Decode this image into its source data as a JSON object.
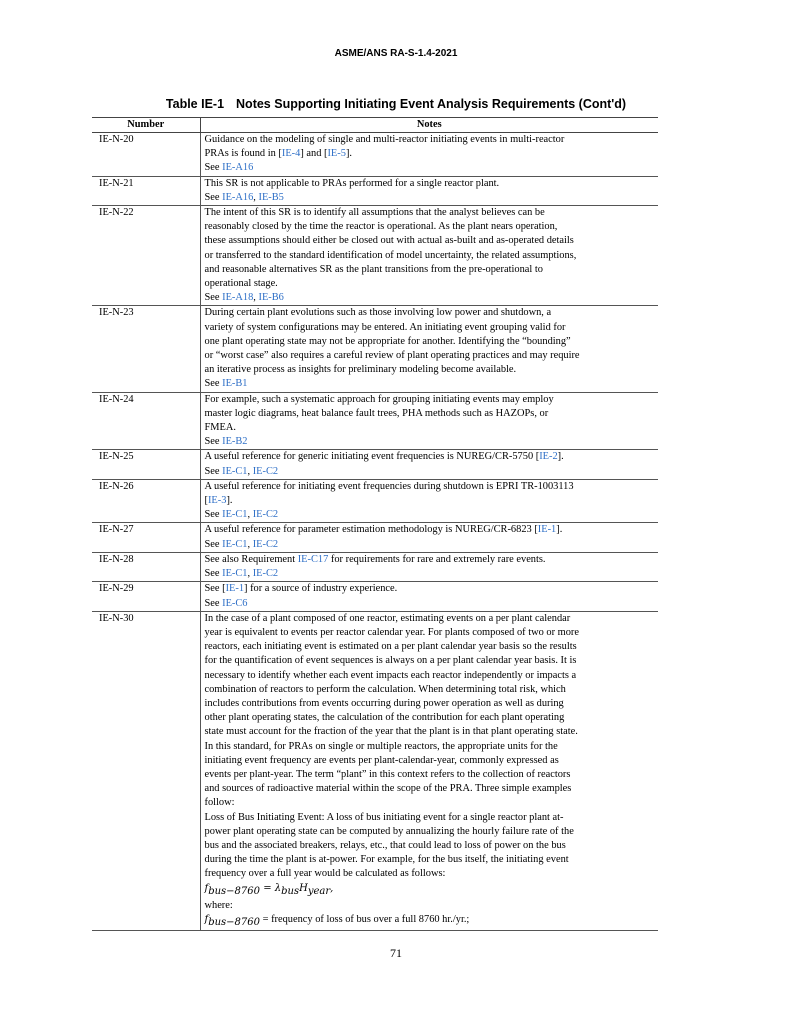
{
  "header": {
    "doc_id": "ASME/ANS RA-S-1.4-2021"
  },
  "table": {
    "label": "Table IE-1",
    "title": "Notes Supporting Initiating Event Analysis Requirements (Cont'd)",
    "col_number": "Number",
    "col_notes": "Notes",
    "rows": [
      {
        "number": "IE-N-20",
        "lines": [
          "Guidance on the modeling of single and multi-reactor initiating events in multi-reactor",
          [
            "PRAs is found in [",
            {
              "l": "IE-4"
            },
            "] and [",
            {
              "l": "IE-5"
            },
            "]."
          ],
          [
            "See ",
            {
              "l": "IE-A16"
            }
          ]
        ]
      },
      {
        "number": "IE-N-21",
        "lines": [
          "This SR is not applicable to PRAs performed for a single reactor plant.",
          [
            "See ",
            {
              "l": "IE-A16"
            },
            ", ",
            {
              "l": "IE-B5"
            }
          ]
        ]
      },
      {
        "number": "IE-N-22",
        "lines": [
          "The intent of this SR is to identify all assumptions that the analyst believes can be",
          "reasonably closed by the time the reactor is operational. As the plant nears operation,",
          "these assumptions should either be closed out with actual as-built and as-operated details",
          "or transferred to the standard identification of model uncertainty, the related assumptions,",
          "and reasonable alternatives SR as the plant transitions from the pre-operational to",
          "operational stage.",
          [
            "See ",
            {
              "l": "IE-A18"
            },
            ", ",
            {
              "l": "IE-B6"
            }
          ]
        ]
      },
      {
        "number": "IE-N-23",
        "lines": [
          "During certain plant evolutions such as those involving low power and shutdown, a",
          "variety of system configurations may be entered. An initiating event grouping valid for",
          "one plant operating state may not be appropriate for another. Identifying the “bounding”",
          "or “worst case” also requires a careful review of plant operating practices and may require",
          "an iterative process as insights for preliminary modeling become available.",
          [
            "See ",
            {
              "l": "IE-B1"
            }
          ]
        ]
      },
      {
        "number": "IE-N-24",
        "lines": [
          "For example, such a systematic approach for grouping initiating events may employ",
          "master logic diagrams, heat balance fault trees, PHA methods such as HAZOPs, or",
          "FMEA.",
          [
            "See ",
            {
              "l": "IE-B2"
            }
          ]
        ]
      },
      {
        "number": "IE-N-25",
        "lines": [
          [
            "A useful reference for generic initiating event frequencies is NUREG/CR-5750 [",
            {
              "l": "IE-2"
            },
            "]."
          ],
          [
            "See ",
            {
              "l": "IE-C1"
            },
            ", ",
            {
              "l": "IE-C2"
            }
          ]
        ]
      },
      {
        "number": "IE-N-26",
        "lines": [
          "A useful reference for initiating event frequencies during shutdown is EPRI TR-1003113",
          [
            "[",
            {
              "l": "IE-3"
            },
            "]."
          ],
          [
            "See ",
            {
              "l": "IE-C1"
            },
            ", ",
            {
              "l": "IE-C2"
            }
          ]
        ]
      },
      {
        "number": "IE-N-27",
        "lines": [
          [
            "A useful reference for parameter estimation methodology is NUREG/CR-6823 [",
            {
              "l": "IE-1"
            },
            "]."
          ],
          [
            "See ",
            {
              "l": "IE-C1"
            },
            ", ",
            {
              "l": "IE-C2"
            }
          ]
        ]
      },
      {
        "number": "IE-N-28",
        "lines": [
          [
            "See also Requirement ",
            {
              "l": "IE-C17"
            },
            " for requirements for rare and extremely rare events."
          ],
          [
            "See ",
            {
              "l": "IE-C1"
            },
            ", ",
            {
              "l": "IE-C2"
            }
          ]
        ]
      },
      {
        "number": "IE-N-29",
        "lines": [
          [
            "See [",
            {
              "l": "IE-1"
            },
            "] for a source of industry experience."
          ],
          [
            "See ",
            {
              "l": "IE-C6"
            }
          ]
        ]
      },
      {
        "number": "IE-N-30",
        "lines": [
          "In the case of a plant composed of one reactor, estimating events on a per plant calendar",
          "year is equivalent to events per reactor calendar year. For plants composed of two or more",
          "reactors, each initiating event is estimated on a per plant calendar year basis so the results",
          "for the quantification of event sequences is always on a per plant calendar year basis. It is",
          "necessary to identify whether each event impacts each reactor independently or impacts a",
          "combination of reactors to perform the calculation. When determining total risk, which",
          "includes contributions from events occurring during power operation as well as during",
          "other plant operating states, the calculation of the contribution for each plant operating",
          "state must account for the fraction of the year that the plant is in that plant operating state.",
          "In this standard, for PRAs on single or multiple reactors, the appropriate units for the",
          "initiating event frequency are events per plant-calendar-year, commonly expressed as",
          "events per plant-year. The term “plant” in this context refers to the collection of reactors",
          "and sources of radioactive material within the scope of the PRA. Three simple examples",
          "follow:",
          "Loss of Bus Initiating Event: A loss of bus initiating event for a single reactor plant at-",
          "power plant operating state can be computed by annualizing the hourly failure rate of the",
          "bus and the associated breakers, relays, etc., that could lead to loss of power on the bus",
          "during the time the plant is at-power. For example, for the bus itself, the initiating event",
          "frequency over a full year would be calculated as follows:",
          [
            {
              "m": "f"
            },
            {
              "s": "bus−8760"
            },
            {
              "m": " = λ"
            },
            {
              "s": "bus"
            },
            {
              "m": "H"
            },
            {
              "s": "year"
            },
            {
              "m": ","
            }
          ],
          "where:",
          [
            {
              "m": "f"
            },
            {
              "s": "bus−8760"
            },
            " = frequency of loss of bus over a full 8760 hr./yr.;"
          ]
        ]
      }
    ]
  },
  "footer": {
    "page_number": "71"
  }
}
